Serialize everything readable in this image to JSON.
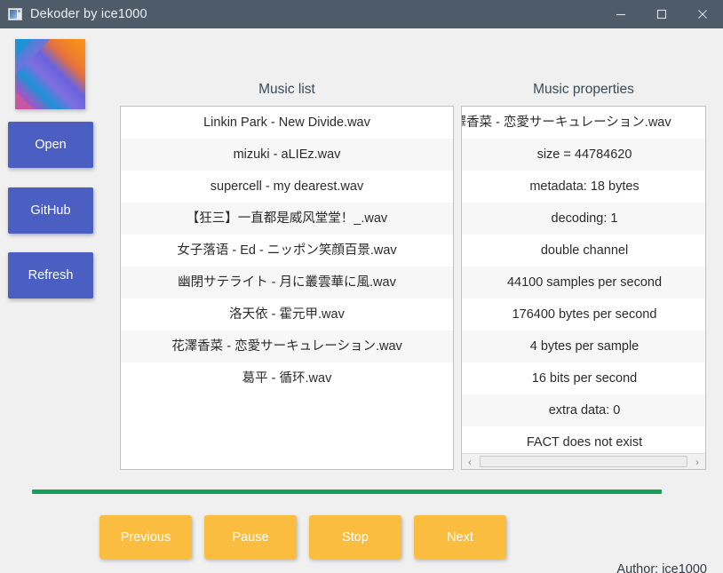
{
  "window": {
    "title": "Dekoder by ice1000",
    "icon": "app-window-icon",
    "minimize_label": "—",
    "maximize_label": "□",
    "close_label": "✕",
    "titlebar_color": "#4e5b68"
  },
  "sidebar": {
    "logo": "kotlin-logo",
    "buttons": [
      {
        "label": "Open",
        "name": "open-button"
      },
      {
        "label": "GitHub",
        "name": "github-button"
      },
      {
        "label": "Refresh",
        "name": "refresh-button"
      }
    ],
    "button_color": "#4a5fc1"
  },
  "music_list": {
    "title": "Music list",
    "items": [
      "Linkin Park - New Divide.wav",
      "mizuki - aLIEz.wav",
      "supercell - my dearest.wav",
      "【狂三】一直都是威风堂堂！_.wav",
      "女子落语 - Ed - ニッポン笑顔百景.wav",
      "幽閉サテライト - 月に叢雲華に風.wav",
      "洛天依 - 霍元甲.wav",
      "花澤香菜 - 恋愛サーキュレーション.wav",
      "葛平 - 循环.wav"
    ]
  },
  "music_properties": {
    "title": "Music properties",
    "items": [
      "花澤香菜 - 恋愛サーキュレーション.wav",
      "size = 44784620",
      "metadata: 18 bytes",
      "decoding: 1",
      "double channel",
      "44100 samples per second",
      "176400 bytes per second",
      "4 bytes per sample",
      "16 bits per second",
      "extra data: 0",
      "FACT does not exist"
    ],
    "scrollbar": {
      "left_arrow": "‹",
      "right_arrow": "›"
    }
  },
  "progress": {
    "name": "playback-progress-bar",
    "color": "#16a05c",
    "value_percent": 100
  },
  "transport": {
    "buttons": [
      {
        "label": "Previous",
        "name": "previous-button"
      },
      {
        "label": "Pause",
        "name": "pause-button"
      },
      {
        "label": "Stop",
        "name": "stop-button"
      },
      {
        "label": "Next",
        "name": "next-button"
      }
    ],
    "button_color": "#fbbd40"
  },
  "footer": {
    "author": "Author: ice1000"
  }
}
